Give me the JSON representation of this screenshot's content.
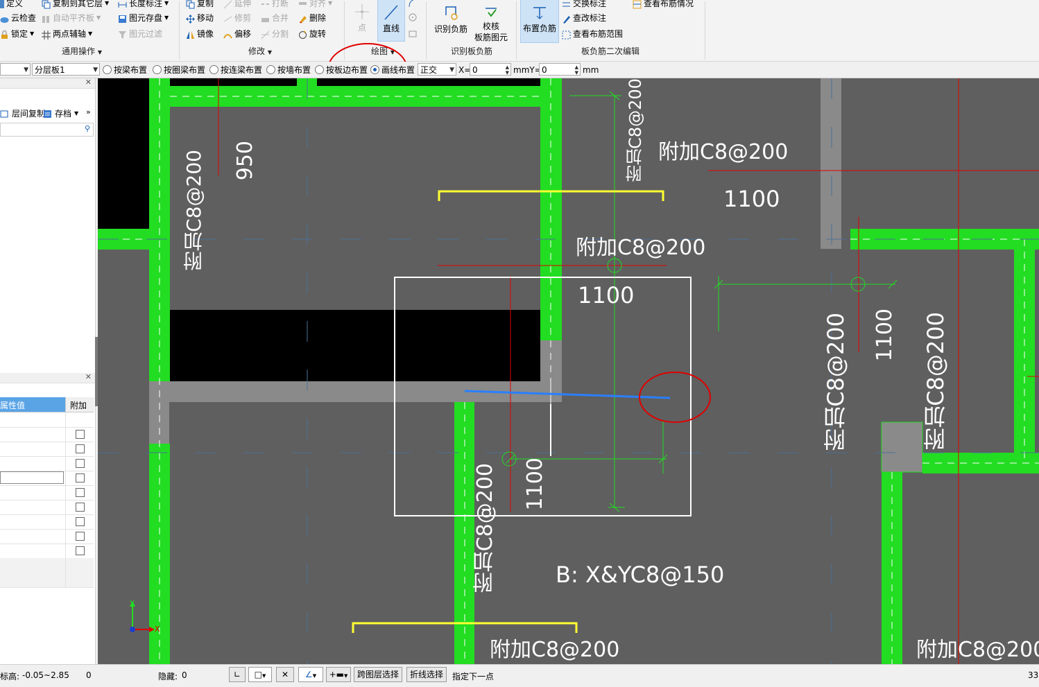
{
  "ribbon": {
    "general": {
      "custom_label": "定义",
      "cloud_check_label": "云检查",
      "lock_label": "锁定",
      "copy_to_floor_label": "复制到其它层",
      "auto_flat_label": "自动平齐板",
      "two_point_axis_label": "两点辅轴",
      "length_mark_label": "长度标注",
      "element_save_label": "图元存盘",
      "element_filter_label": "图元过滤",
      "group_label": "通用操作"
    },
    "modify": {
      "copy_label": "复制",
      "move_label": "移动",
      "mirror_label": "镜像",
      "extend_label": "延伸",
      "trim_label": "修剪",
      "offset_label": "偏移",
      "break_label": "打断",
      "merge_label": "合并",
      "split_label": "分割",
      "align_label": "对齐",
      "delete_label": "删除",
      "rotate_label": "旋转",
      "group_label": "修改"
    },
    "draw": {
      "point_label": "点",
      "line_label": "直线",
      "group_label": "绘图"
    },
    "identify": {
      "identify_neg_label": "识别负筋",
      "check_label_1": "校核",
      "check_label_2": "板筋图元",
      "group_label": "识别板负筋"
    },
    "edit2": {
      "place_neg_label": "布置负筋",
      "swap_mark_label": "交换标注",
      "check_mark_label": "查改标注",
      "view_range_label": "查看布筋范围",
      "view_layout_label": "查看布筋情况",
      "group_label": "板负筋二次编辑"
    }
  },
  "toolbar": {
    "layer_value": "分层板1",
    "options": [
      "按梁布置",
      "按圈梁布置",
      "按连梁布置",
      "按墙布置",
      "按板边布置",
      "画线布置"
    ],
    "selected_option": "画线布置",
    "mode_value": "正交",
    "x_label": "X=",
    "x_value": "0",
    "y_label": "mmY=",
    "y_value": "0",
    "unit": "mm"
  },
  "left_panel": {
    "floor_copy_label": "层间复制",
    "archive_label": "存档",
    "prop_header_value": "属性值",
    "prop_header_extra": "附加"
  },
  "canvas": {
    "labels": {
      "l1": "附加C8@200",
      "l2": "950",
      "l3": "附加C8@200",
      "l4": "附加C8@200",
      "l5": "1100",
      "l6": "附加C8@200",
      "l7": "1100",
      "l8": "附加C8@200",
      "l9": "1100",
      "l10": "附加C8@200",
      "l11": "附加C8@200",
      "l12": "1100",
      "l13": "B: X&YC8@150",
      "l14": "附加C8@200",
      "l15": "附加C8@200"
    },
    "axis_x": "X",
    "axis_y": "Y"
  },
  "status": {
    "elevation_label": "标高:",
    "elevation_value": "-0.05~2.85",
    "count_value": "0",
    "hidden_label": "隐藏:",
    "hidden_value": "0",
    "cross_layer_label": "跨图层选择",
    "polyline_label": "折线选择",
    "prompt": "指定下一点",
    "right_value": "33"
  },
  "colors": {
    "canvas_bg": "#5f5f5f",
    "wall_green": "#22dd22",
    "highlight_red": "#e00000",
    "rebar_blue": "#2a7fff",
    "selection_tab": "#cfe3f7"
  }
}
